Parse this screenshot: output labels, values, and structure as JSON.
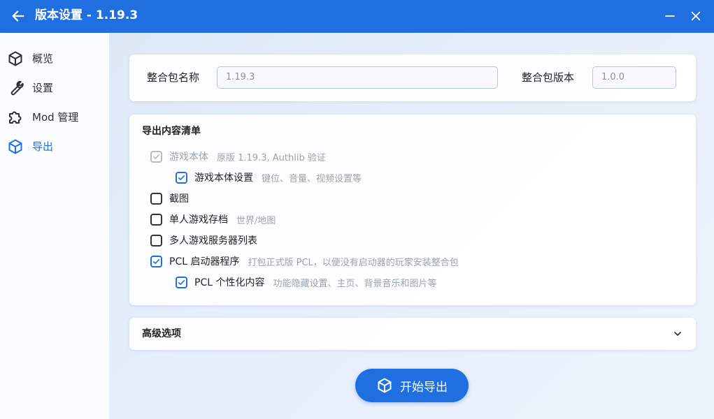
{
  "window": {
    "title": "版本设置 - 1.19.3",
    "accent": "#1f6fe0"
  },
  "sidebar": {
    "items": [
      {
        "label": "概览",
        "icon": "cube-outline-icon",
        "active": false
      },
      {
        "label": "设置",
        "icon": "wrench-icon",
        "active": false
      },
      {
        "label": "Mod 管理",
        "icon": "puzzle-icon",
        "active": false
      },
      {
        "label": "导出",
        "icon": "box-icon",
        "active": true
      }
    ]
  },
  "pack": {
    "name_label": "整合包名称",
    "name_placeholder": "1.19.3",
    "version_label": "整合包版本",
    "version_placeholder": "1.0.0"
  },
  "export_list": {
    "title": "导出内容清单",
    "options": [
      {
        "label": "游戏本体",
        "desc": "原版 1.19.3, Authlib 验证",
        "checked": true,
        "disabled": true,
        "indent": 0
      },
      {
        "label": "游戏本体设置",
        "desc": "键位、音量、视频设置等",
        "checked": true,
        "disabled": false,
        "indent": 1
      },
      {
        "label": "截图",
        "desc": "",
        "checked": false,
        "disabled": false,
        "indent": 0
      },
      {
        "label": "单人游戏存档",
        "desc": "世界/地图",
        "checked": false,
        "disabled": false,
        "indent": 0
      },
      {
        "label": "多人游戏服务器列表",
        "desc": "",
        "checked": false,
        "disabled": false,
        "indent": 0
      },
      {
        "label": "PCL 启动器程序",
        "desc": "打包正式版 PCL，以便没有启动器的玩家安装整合包",
        "checked": true,
        "disabled": false,
        "indent": 0
      },
      {
        "label": "PCL 个性化内容",
        "desc": "功能隐藏设置、主页、背景音乐和图片等",
        "checked": true,
        "disabled": false,
        "indent": 1
      }
    ]
  },
  "advanced": {
    "title": "高级选项"
  },
  "actions": {
    "export_label": "开始导出"
  }
}
